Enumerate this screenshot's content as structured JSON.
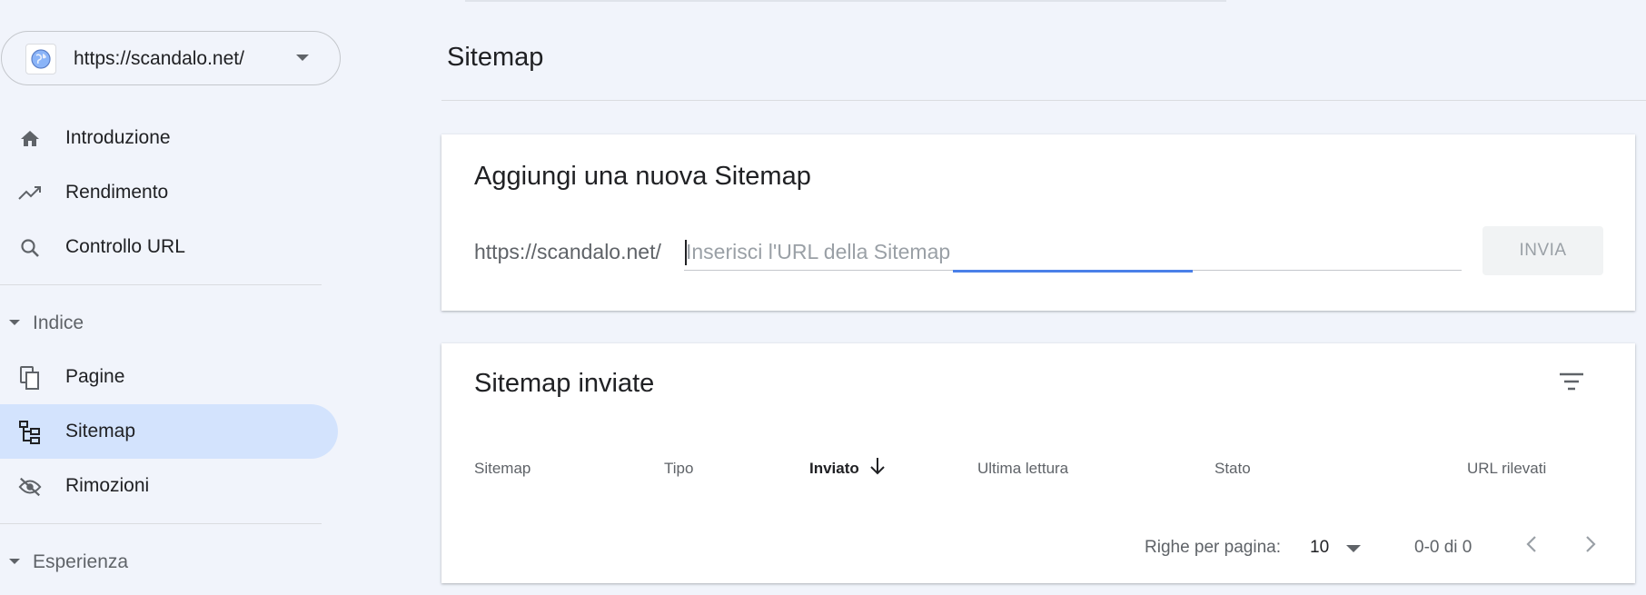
{
  "property": {
    "url": "https://scandalo.net/",
    "icon": "globe-icon"
  },
  "sidebar": {
    "items": [
      {
        "label": "Introduzione",
        "icon": "home-icon"
      },
      {
        "label": "Rendimento",
        "icon": "trending-up-icon"
      },
      {
        "label": "Controllo URL",
        "icon": "search-icon"
      }
    ],
    "sections": [
      {
        "label": "Indice",
        "items": [
          {
            "label": "Pagine",
            "icon": "pages-icon"
          },
          {
            "label": "Sitemap",
            "icon": "sitemap-icon",
            "active": true
          },
          {
            "label": "Rimozioni",
            "icon": "visibility-off-icon"
          }
        ]
      },
      {
        "label": "Esperienza",
        "items": []
      }
    ]
  },
  "page": {
    "title": "Sitemap"
  },
  "add_sitemap": {
    "title": "Aggiungi una nuova Sitemap",
    "prefix": "https://scandalo.net/",
    "input_value": "",
    "placeholder": "Inserisci l'URL della Sitemap",
    "submit_label": "INVIA"
  },
  "submitted": {
    "title": "Sitemap inviate",
    "filter_icon": "filter-list-icon",
    "columns": [
      "Sitemap",
      "Tipo",
      "Inviato",
      "Ultima lettura",
      "Stato",
      "URL rilevati"
    ],
    "sorted_column": "Inviato",
    "sort_direction": "descending",
    "rows": [],
    "pagination": {
      "rows_per_page_label": "Righe per pagina:",
      "rows_per_page": "10",
      "range": "0-0 di 0"
    }
  },
  "colors": {
    "background": "#f1f4fb",
    "active_nav": "#d3e3fd",
    "accent": "#4a80e8"
  }
}
